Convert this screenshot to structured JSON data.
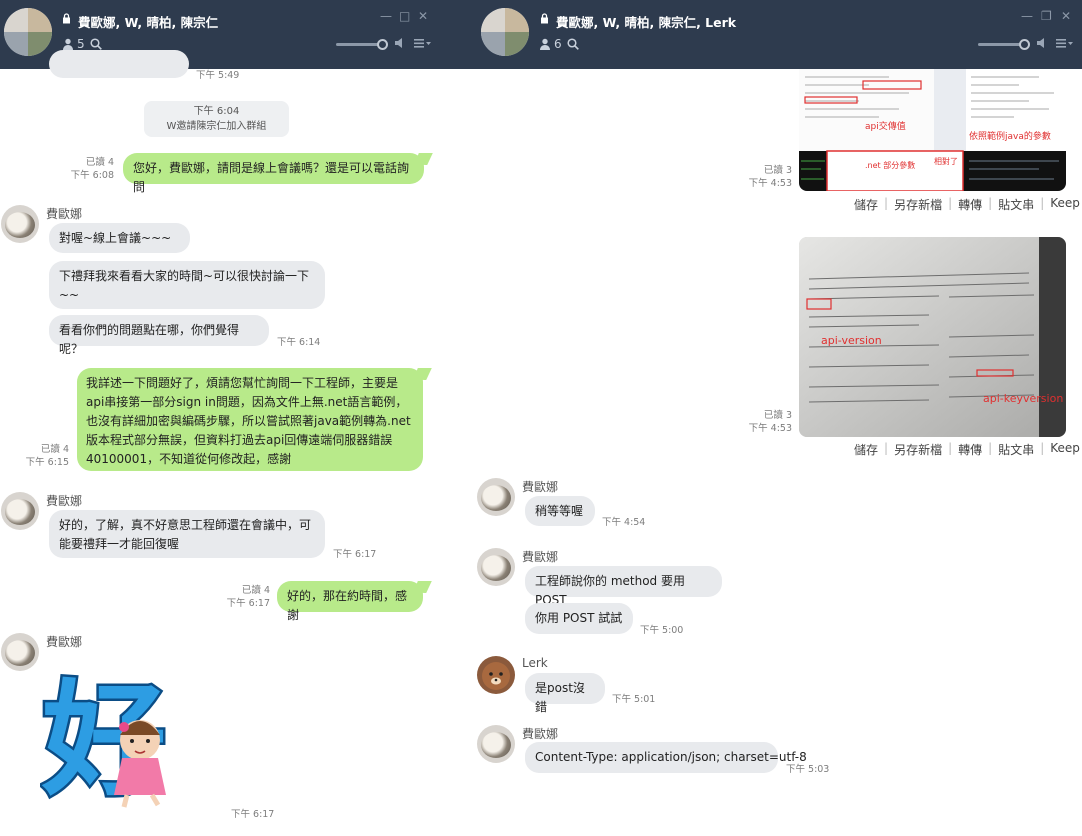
{
  "left": {
    "title": "費歐娜, W, 晴柏, 陳宗仁",
    "member_count": "5",
    "partial_time": "下午 5:49",
    "system": {
      "time": "下午 6:04",
      "text": "W邀請陳宗仁加入群組"
    },
    "messages": [
      {
        "read": "已讀 4",
        "time": "下午 6:08",
        "text": "您好，費歐娜，請問是線上會議嗎？還是可以電話詢問"
      },
      {
        "sender": "費歐娜",
        "texts": [
          "對喔~線上會議~~~",
          "下禮拜我來看看大家的時間~可以很快討論一下~~",
          "看看你們的問題點在哪，你們覺得呢？"
        ],
        "time": "下午 6:14"
      },
      {
        "read": "已讀 4",
        "time": "下午 6:15",
        "text": "我詳述一下問題好了，煩請您幫忙詢問一下工程師，主要是api串接第一部分sign in問題，因為文件上無.net語言範例，也沒有詳細加密與編碼步驟，所以嘗試照著java範例轉為.net版本程式部分無誤，但資料打過去api回傳遠端伺服器錯誤40100001，不知道從何修改起，感謝"
      },
      {
        "sender": "費歐娜",
        "text": "好的，了解，真不好意思工程師還在會議中，可能要禮拜一才能回復喔",
        "time": "下午 6:17"
      },
      {
        "read": "已讀 4",
        "time": "下午 6:17",
        "text": "好的，那在約時間，感謝"
      },
      {
        "sender": "費歐娜",
        "sticker": "好",
        "time": "下午 6:17"
      }
    ]
  },
  "right": {
    "title": "費歐娜, W, 晴柏, 陳宗仁, Lerk",
    "member_count": "6",
    "image1": {
      "read": "已讀 3",
      "time": "下午 4:53",
      "label_a": "api交傳值",
      "label_b": "依照範例java的參數",
      "label_c": ".net 部分參數",
      "label_d": "相對了"
    },
    "image2": {
      "read": "已讀 3",
      "time": "下午 4:53",
      "label_a": "api-version",
      "label_b": "api-keyversion"
    },
    "actions": [
      "儲存",
      "另存新檔",
      "轉傳",
      "貼文串",
      "Keep"
    ],
    "messages": [
      {
        "sender": "費歐娜",
        "texts": [
          "稍等等喔"
        ],
        "time": "下午 4:54"
      },
      {
        "sender": "費歐娜",
        "texts": [
          "工程師說你的 method 要用 POST",
          "你用 POST 試試"
        ],
        "time": "下午 5:00"
      },
      {
        "sender": "Lerk",
        "texts": [
          "是post沒錯"
        ],
        "time": "下午 5:01"
      },
      {
        "sender": "費歐娜",
        "texts": [
          "Content-Type: application/json; charset=utf-8"
        ],
        "time": "下午 5:03"
      }
    ]
  },
  "icons": [
    "lock-icon",
    "members-icon",
    "search-icon",
    "minimize-icon",
    "maximize-icon",
    "close-icon",
    "volume-icon",
    "menu-icon"
  ]
}
